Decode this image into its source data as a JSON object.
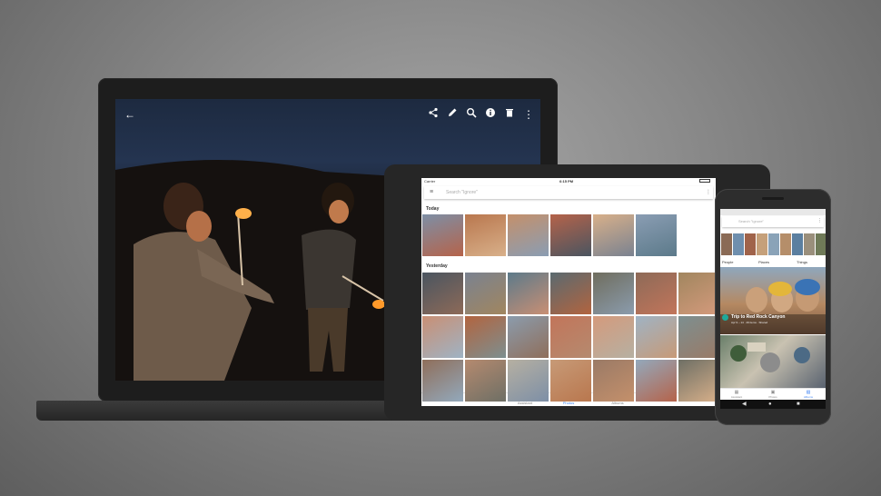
{
  "laptop": {
    "back_icon": "arrow-left-icon",
    "toolbar_icons": [
      "share-icon",
      "edit-icon",
      "zoom-icon",
      "info-icon",
      "trash-icon",
      "more-vert-icon"
    ]
  },
  "tablet": {
    "status": {
      "carrier": "Carrier",
      "time": "6:15 PM"
    },
    "search": {
      "placeholder": "Search \"Ignore\""
    },
    "sections": [
      {
        "label": "Today",
        "rows": 1
      },
      {
        "label": "Yesterday",
        "rows": 3
      }
    ],
    "nav": [
      {
        "label": "Assistant",
        "icon": "assistant-icon",
        "active": false
      },
      {
        "label": "Photos",
        "icon": "photos-icon",
        "active": true
      },
      {
        "label": "Albums",
        "icon": "albums-icon",
        "active": false
      }
    ],
    "colors": {
      "accent": "#4285f4"
    }
  },
  "phone": {
    "search": {
      "placeholder": "Search \"Ignore\""
    },
    "chips": [
      {
        "label": "People"
      },
      {
        "label": "Places"
      },
      {
        "label": "Things"
      }
    ],
    "album": {
      "title": "Trip to Red Rock Canyon",
      "meta": "Apr 9 – 14 · 29 items · Shared"
    },
    "nav": [
      {
        "label": "Assistant",
        "icon": "assistant-icon",
        "active": false
      },
      {
        "label": "Photos",
        "icon": "photos-icon",
        "active": false
      },
      {
        "label": "Albums",
        "icon": "albums-icon",
        "active": true
      }
    ]
  }
}
